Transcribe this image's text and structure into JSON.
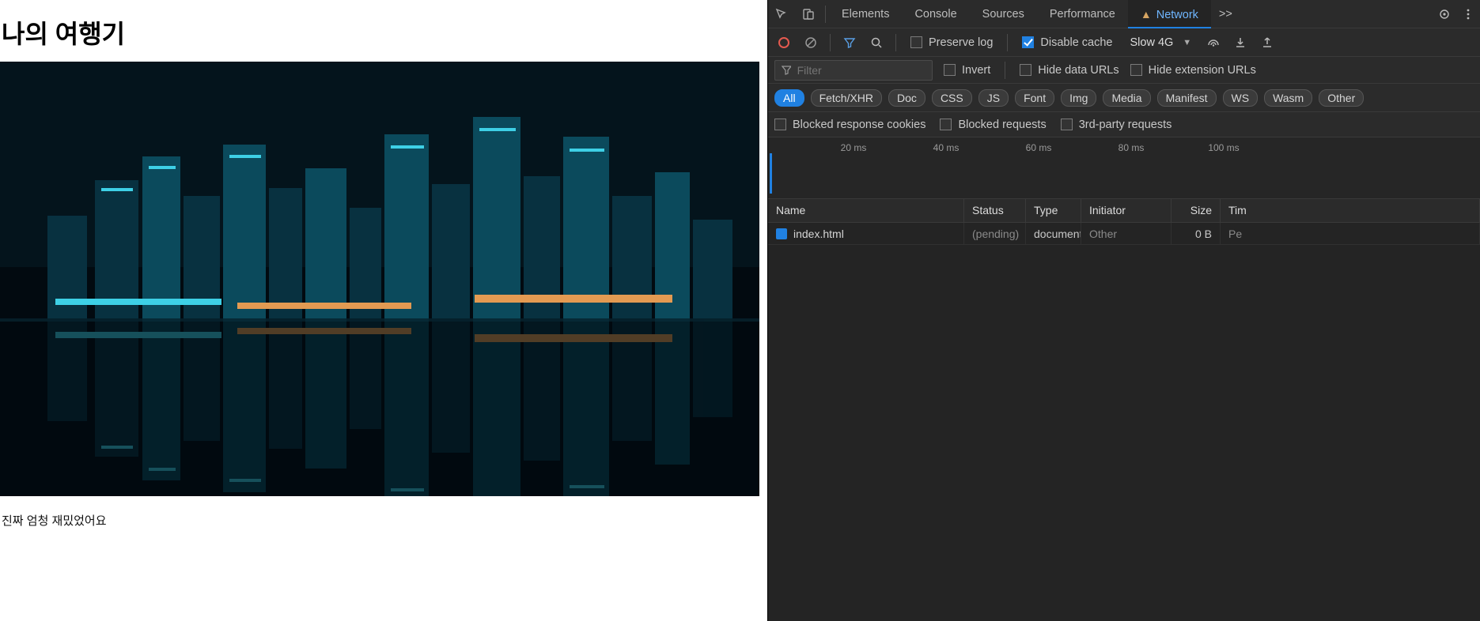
{
  "page": {
    "title": "나의 여행기",
    "caption": "진짜 엄청 재밌었어요"
  },
  "devtools": {
    "tabs": [
      "Elements",
      "Console",
      "Sources",
      "Performance",
      "Network"
    ],
    "active_tab": "Network",
    "more_label": ">>",
    "toolbar": {
      "preserve_log": "Preserve log",
      "disable_cache": "Disable cache",
      "throttle": "Slow 4G"
    },
    "filter": {
      "placeholder": "Filter",
      "invert": "Invert",
      "hide_data_urls": "Hide data URLs",
      "hide_ext_urls": "Hide extension URLs"
    },
    "pills": [
      "All",
      "Fetch/XHR",
      "Doc",
      "CSS",
      "JS",
      "Font",
      "Img",
      "Media",
      "Manifest",
      "WS",
      "Wasm",
      "Other"
    ],
    "active_pill": "All",
    "extra": {
      "blocked_cookies": "Blocked response cookies",
      "blocked_requests": "Blocked requests",
      "third_party": "3rd-party requests"
    },
    "timeline_ticks": [
      "20 ms",
      "40 ms",
      "60 ms",
      "80 ms",
      "100 ms"
    ],
    "columns": {
      "name": "Name",
      "status": "Status",
      "type": "Type",
      "initiator": "Initiator",
      "size": "Size",
      "time": "Tim"
    },
    "rows": [
      {
        "name": "index.html",
        "status": "(pending)",
        "type": "document",
        "initiator": "Other",
        "size": "0 B",
        "time": "Pe"
      }
    ]
  }
}
